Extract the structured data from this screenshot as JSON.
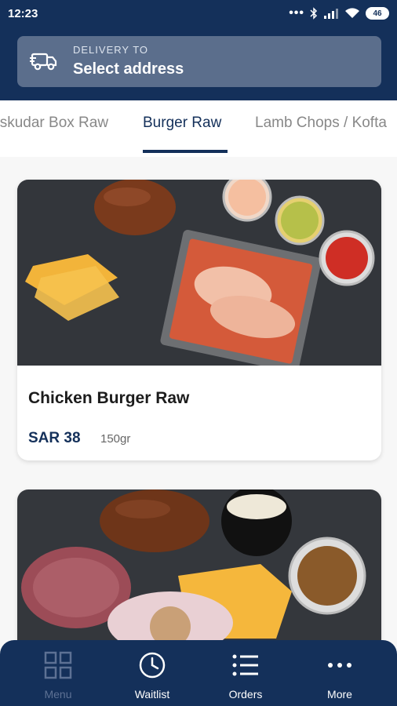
{
  "status_bar": {
    "time": "12:23",
    "dots": "•••",
    "battery": "46"
  },
  "delivery": {
    "label": "DELIVERY TO",
    "value": "Select address"
  },
  "tabs": [
    {
      "label": "Üskudar Box Raw"
    },
    {
      "label": "Burger Raw"
    },
    {
      "label": "Lamb Chops / Kofta"
    }
  ],
  "products": [
    {
      "name": "Chicken Burger Raw",
      "price": "SAR 38",
      "weight": "150gr"
    },
    {
      "name": "",
      "price": "",
      "weight": ""
    }
  ],
  "bottom_nav": [
    {
      "label": "Menu",
      "icon": "grid-icon"
    },
    {
      "label": "Waitlist",
      "icon": "clock-icon"
    },
    {
      "label": "Orders",
      "icon": "list-icon"
    },
    {
      "label": "More",
      "icon": "more-dots-icon"
    }
  ],
  "colors": {
    "primary": "#14305a",
    "delivery_box": "#5b6e8c",
    "background": "#f7f7f7"
  }
}
